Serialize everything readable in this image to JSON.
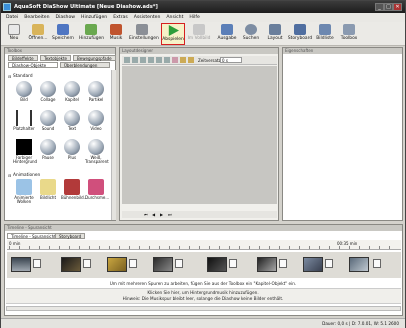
{
  "window": {
    "title": "AquaSoft DiaShow Ultimate [Neue Diashow.ads*]",
    "controls": [
      "_",
      "□",
      "✕"
    ]
  },
  "menu": [
    "Datei",
    "Bearbeiten",
    "Diashow",
    "Hinzufügen",
    "Extras",
    "Assistenten",
    "Ansicht",
    "Hilfe"
  ],
  "toolbar": [
    {
      "label": "Neu",
      "color": "#e8e8e8"
    },
    {
      "label": "Öffnen...",
      "color": "#d9b45a"
    },
    {
      "label": "Speichern",
      "color": "#4f76c2"
    },
    {
      "label": "Hinzufügen",
      "color": "#6aa84f"
    },
    {
      "label": "Musik",
      "color": "#c0542e"
    },
    {
      "label": "Einstellungen",
      "color": "#8b8f96"
    },
    {
      "label": "Abspielen",
      "color": "#2d9e3a"
    },
    {
      "label": "Im Vollbild",
      "color": "#b8b8b8"
    },
    {
      "label": "Ausgabe",
      "color": "#5b7fb8"
    },
    {
      "label": "Suchen",
      "color": "#7d8da3"
    },
    {
      "label": "Layout",
      "color": "#6a7f9c"
    },
    {
      "label": "Storyboard",
      "color": "#4f6ea0"
    },
    {
      "label": "Bildliste",
      "color": "#6d88b0"
    },
    {
      "label": "Toolbox",
      "color": "#8a9ab0"
    }
  ],
  "toolbox": {
    "header": "Toolbox",
    "tabs_row1": [
      "Bildeffekte",
      "Textobjekte",
      "Bewegungspfade"
    ],
    "tabs_row2": [
      "Diashow-Objekte",
      "Überblendungen"
    ],
    "section_standard": "Standard",
    "items": [
      [
        "Bild",
        "Collage",
        "Kapitel",
        "Partikel"
      ],
      [
        "Platzhalter",
        "Sound",
        "Text",
        "Video"
      ],
      [
        "Farbiger Hintergrund",
        "Pause",
        "Plus",
        "Weiß, Transparent"
      ]
    ],
    "section_animationen": "Animationen",
    "anim_items": [
      "Animierte Wolken",
      "Bildlicht",
      "Bühnenbild...",
      "Durchsme..."
    ]
  },
  "preview": {
    "header": "Layoutdesigner",
    "zoom_label": "Zeitversatz:",
    "zoom_value": "0 s"
  },
  "properties": {
    "header": "Eigenschaften"
  },
  "timeline": {
    "header": "Timeline - Spuransicht",
    "tabs": [
      "Timeline - Spuransicht",
      "Storyboard"
    ],
    "ruler_start": "0 min",
    "ruler_end": "00:35 min",
    "hint1": "Um mit mehreren Spuren zu arbeiten, fügen Sie aus der Toolbox ein \"Kapitel-Objekt\" ein.",
    "hint2": "Klicken Sie hier, um Hintergrundmusik hinzuzufügen.",
    "hint3": "Hinweis: Die Musikspur bleibt leer, solange die Diashow keine Bilder enthält."
  },
  "status": {
    "text": "Dauer: 0,0 s | D: 7.0.01, W: 5.1 2600"
  }
}
